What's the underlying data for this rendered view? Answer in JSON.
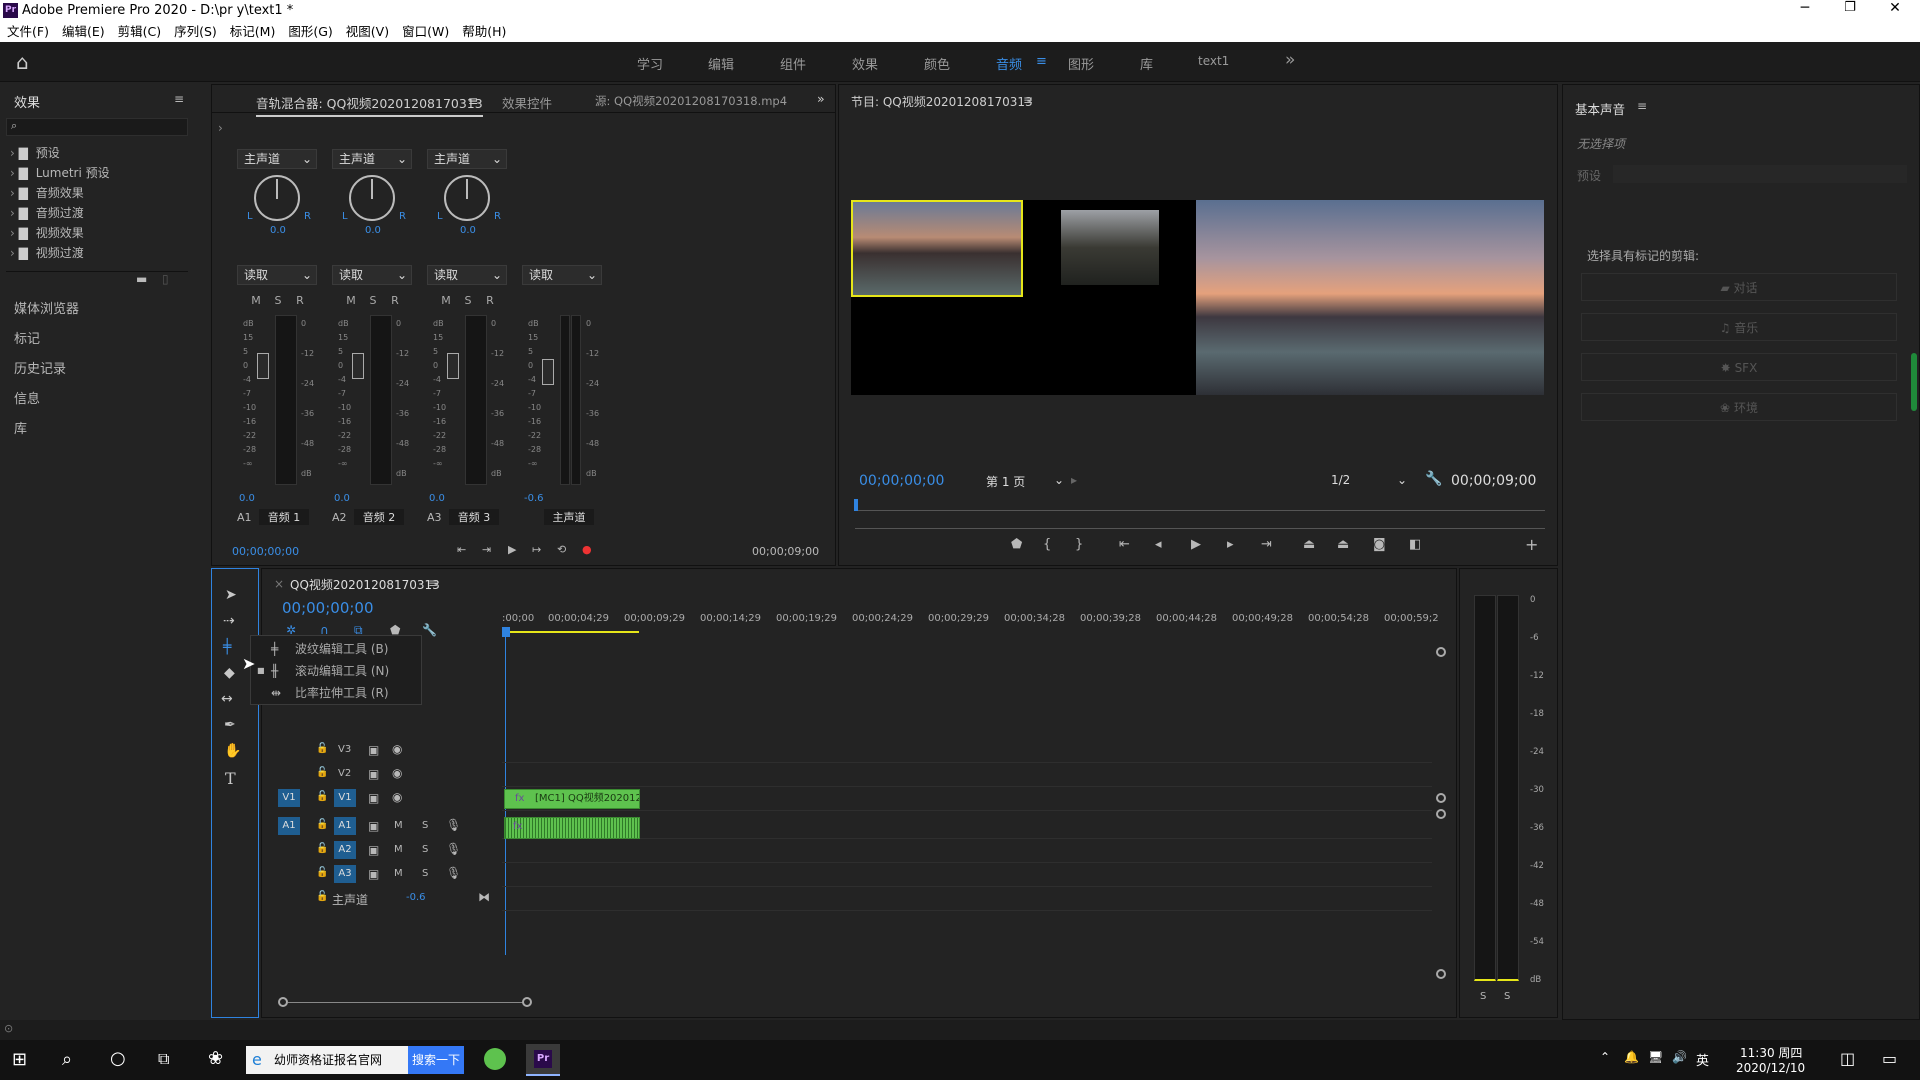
{
  "app": {
    "title": "Adobe Premiere Pro 2020 - D:\\pr y\\text1 *"
  },
  "menu": [
    "文件(F)",
    "编辑(E)",
    "剪辑(C)",
    "序列(S)",
    "标记(M)",
    "图形(G)",
    "视图(V)",
    "窗口(W)",
    "帮助(H)"
  ],
  "workspaces": {
    "items": [
      "学习",
      "编辑",
      "组件",
      "效果",
      "颜色",
      "音频",
      "图形",
      "库",
      "text1"
    ],
    "active": "音频",
    "more": "»"
  },
  "effects_panel": {
    "title": "效果",
    "folders": [
      "预设",
      "Lumetri 预设",
      "音频效果",
      "音频过渡",
      "视频效果",
      "视频过渡"
    ],
    "other_panels": [
      "媒体浏览器",
      "标记",
      "历史记录",
      "信息",
      "库"
    ]
  },
  "mixer": {
    "tabs": [
      "音轨混合器: QQ视频20201208170313",
      "效果控件",
      "源: QQ视频20201208170318.mp4"
    ],
    "channel_dd": "主声道",
    "read_dd": "读取",
    "msr": [
      "M",
      "S",
      "R"
    ],
    "knob_lr": [
      "L",
      "R"
    ],
    "knob_value": "0.0",
    "db_label": "dB",
    "scale": [
      "0",
      "-12",
      "-24",
      "-36",
      "-48",
      "dB"
    ],
    "fader_scale": [
      "15",
      "5",
      "0",
      "-4",
      "-7",
      "-10",
      "-16",
      "-22",
      "-28",
      "-∞"
    ],
    "channels": [
      {
        "id": "A1",
        "name": "音频 1",
        "value": "0.0"
      },
      {
        "id": "A2",
        "name": "音频 2",
        "value": "0.0"
      },
      {
        "id": "A3",
        "name": "音频 3",
        "value": "0.0"
      },
      {
        "id": "",
        "name": "主声道",
        "value": "-0.6"
      }
    ],
    "time_in": "00;00;00;00",
    "time_out": "00;00;09;00"
  },
  "program": {
    "title": "节目: QQ视频20201208170313",
    "timecode": "00;00;00;00",
    "page": "第 1 页",
    "zoom": "1/2",
    "duration": "00;00;09;00"
  },
  "essential_sound": {
    "title": "基本声音",
    "no_selection": "无选择项",
    "preset_label": "预设",
    "prompt": "选择具有标记的剪辑:",
    "buttons": [
      "对话",
      "音乐",
      "SFX",
      "环境"
    ]
  },
  "timeline": {
    "sequence_tab": "QQ视频20201208170313",
    "timecode": "00;00;00;00",
    "ruler": [
      ":00;00",
      "00;00;04;29",
      "00;00;09;29",
      "00;00;14;29",
      "00;00;19;29",
      "00;00;24;29",
      "00;00;29;29",
      "00;00;34;28",
      "00;00;39;28",
      "00;00;44;28",
      "00;00;49;28",
      "00;00;54;28",
      "00;00;59;2"
    ],
    "video_tracks": [
      "V3",
      "V2",
      "V1"
    ],
    "audio_tracks": [
      "A1",
      "A2",
      "A3"
    ],
    "master_label": "主声道",
    "master_value": "-0.6",
    "clip_label": "[MC1] QQ视频2020120",
    "tool_menu": [
      {
        "label": "波纹编辑工具 (B)"
      },
      {
        "label": "滚动编辑工具 (N)"
      },
      {
        "label": "比率拉伸工具 (R)"
      }
    ],
    "meter_scale": [
      "0",
      "-6",
      "-12",
      "-18",
      "-24",
      "-30",
      "-36",
      "-42",
      "-48",
      "-54",
      "dB"
    ],
    "meter_solo": [
      "S",
      "S"
    ]
  },
  "taskbar": {
    "browser_tab": "幼师资格证报名官网",
    "search_btn": "搜索一下",
    "ime": "英",
    "time": "11:30 周四",
    "date": "2020/12/10",
    "app_label": "Pr"
  },
  "colors": {
    "accent": "#3a8ee6",
    "clip_green": "#5ec24e",
    "playhead": "#2f83e0",
    "selection": "#e6e619"
  }
}
